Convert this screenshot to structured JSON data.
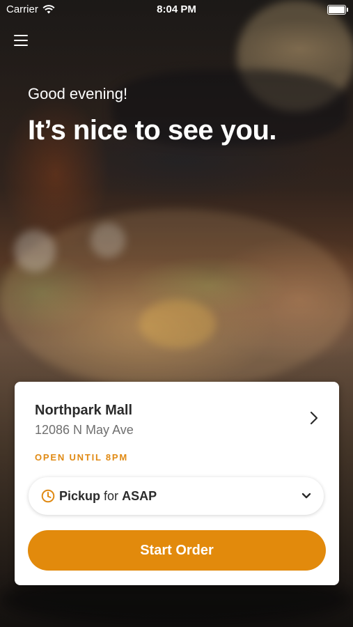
{
  "status_bar": {
    "carrier": "Carrier",
    "time": "8:04 PM"
  },
  "hero": {
    "greeting": "Good evening!",
    "headline": "It’s nice to see you."
  },
  "location_card": {
    "name": "Northpark Mall",
    "address": "12086 N May Ave",
    "hours": "OPEN UNTIL 8PM",
    "order_mode": "Pickup",
    "order_mode_connector": "for",
    "order_time": "ASAP",
    "start_order_label": "Start Order"
  },
  "colors": {
    "accent": "#e28a0c",
    "hours_text": "#e08a14",
    "card_bg": "#ffffff"
  },
  "icons": {
    "menu": "hamburger-menu-icon",
    "location_chevron": "chevron-right-icon",
    "clock": "clock-icon",
    "dropdown": "chevron-down-icon",
    "wifi": "wifi-icon",
    "battery": "battery-icon"
  }
}
